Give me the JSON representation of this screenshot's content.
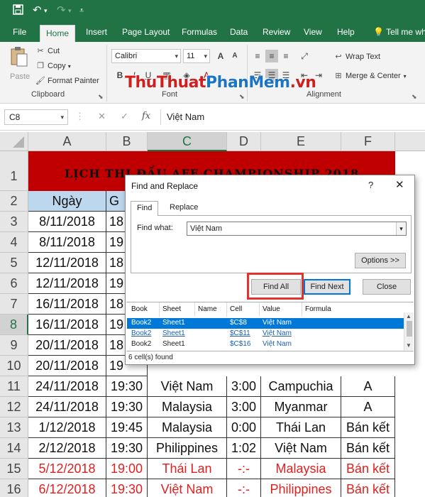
{
  "quick_access": {
    "save_icon": "save-icon",
    "undo_icon": "undo-icon",
    "redo_icon": "redo-icon",
    "customize_icon": "customize-icon"
  },
  "tabs": [
    "File",
    "Home",
    "Insert",
    "Page Layout",
    "Formulas",
    "Data",
    "Review",
    "View",
    "Help",
    "Tell me wh"
  ],
  "active_tab": "Home",
  "ribbon": {
    "paste": "Paste",
    "cut": "Cut",
    "copy": "Copy",
    "format_painter": "Format Painter",
    "clipboard_label": "Clipboard",
    "font_name": "Calibri",
    "font_size": "11",
    "font_label": "Font",
    "wrap_text": "Wrap Text",
    "merge_center": "Merge & Center",
    "alignment_label": "Alignment"
  },
  "watermark": {
    "part1": "ThuThuat",
    "part2": "PhanMem",
    "part3": ".vn"
  },
  "formula_bar": {
    "name_box": "C8",
    "fx": "fx",
    "cancel": "✕",
    "enter": "✓",
    "value": "Việt Nam"
  },
  "columns": [
    "A",
    "B",
    "C",
    "D",
    "E",
    "F"
  ],
  "selected_column": "C",
  "selected_row": "8",
  "sheet": {
    "title": "LỊCH THI ĐẤU AFF CHAMPIONSHIP 2018",
    "header": {
      "a": "Ngày",
      "b": "G"
    },
    "rows": [
      {
        "num": "3",
        "a": "8/11/2018",
        "b": "18"
      },
      {
        "num": "4",
        "a": "8/11/2018",
        "b": "19"
      },
      {
        "num": "5",
        "a": "12/11/2018",
        "b": "18"
      },
      {
        "num": "6",
        "a": "12/11/2018",
        "b": "19"
      },
      {
        "num": "7",
        "a": "16/11/2018",
        "b": "18"
      },
      {
        "num": "8",
        "a": "16/11/2018",
        "b": "19"
      },
      {
        "num": "9",
        "a": "20/11/2018",
        "b": "18"
      },
      {
        "num": "10",
        "a": "20/11/2018",
        "b": "19"
      },
      {
        "num": "11",
        "a": "24/11/2018",
        "b": "19:30",
        "c": "Việt Nam",
        "d": "3:00",
        "e": "Campuchia",
        "f": "A"
      },
      {
        "num": "12",
        "a": "24/11/2018",
        "b": "19:30",
        "c": "Malaysia",
        "d": "3:00",
        "e": "Myanmar",
        "f": "A"
      },
      {
        "num": "13",
        "a": "1/12/2018",
        "b": "19:45",
        "c": "Malaysia",
        "d": "0:00",
        "e": "Thái Lan",
        "f": "Bán kết"
      },
      {
        "num": "14",
        "a": "2/12/2018",
        "b": "19:30",
        "c": "Philippines",
        "d": "1:02",
        "e": "Việt Nam",
        "f": "Bán kết"
      },
      {
        "num": "15",
        "a": "5/12/2018",
        "b": "19:00",
        "c": "Thái Lan",
        "d": "-:-",
        "e": "Malaysia",
        "f": "Bán kết"
      },
      {
        "num": "16",
        "a": "6/12/2018",
        "b": "19:30",
        "c": "Việt Nam",
        "d": "-:-",
        "e": "Philippines",
        "f": "Bán kết"
      }
    ],
    "row_labels": {
      "r1": "1",
      "r2": "2"
    }
  },
  "dialog": {
    "title": "Find and Replace",
    "help": "?",
    "close": "✕",
    "tab_find": "Find",
    "tab_replace": "Replace",
    "find_what_label": "Find what:",
    "find_what_value": "Việt Nam",
    "options_button": "Options >>",
    "find_all_button": "Find All",
    "find_next_button": "Find Next",
    "close_button": "Close",
    "result_headers": [
      "Book",
      "Sheet",
      "Name",
      "Cell",
      "Value",
      "Formula"
    ],
    "results": [
      {
        "book": "Book2",
        "sheet": "Sheet1",
        "name": "",
        "cell": "$C$8",
        "value": "Việt Nam",
        "formula": ""
      },
      {
        "book": "Book2",
        "sheet": "Sheet1",
        "name": "",
        "cell": "$C$11",
        "value": "Việt Nam",
        "formula": ""
      },
      {
        "book": "Book2",
        "sheet": "Sheet1",
        "name": "",
        "cell": "$C$16",
        "value": "Việt Nam",
        "formula": ""
      }
    ],
    "status": "6 cell(s) found"
  },
  "colors": {
    "excel_green": "#217346",
    "title_red": "#c00000",
    "header_blue": "#bdd7ee",
    "text_red": "#e21f1f",
    "highlight_box": "#e0342f",
    "selection_blue": "#0078d7"
  }
}
